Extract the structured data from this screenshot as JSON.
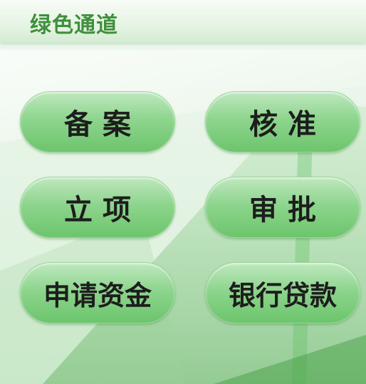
{
  "header": {
    "title": "绿色通道"
  },
  "buttons": [
    {
      "id": "filing",
      "label": "备案"
    },
    {
      "id": "approval-check",
      "label": "核准"
    },
    {
      "id": "project-setup",
      "label": "立项"
    },
    {
      "id": "review",
      "label": "审批"
    },
    {
      "id": "fund-application",
      "label": "申请资金"
    },
    {
      "id": "bank-loan",
      "label": "银行贷款"
    }
  ],
  "colors": {
    "accent": "#3f8f3c",
    "button_top": "#bfe8bf",
    "button_bottom": "#6cc56c",
    "background": "#e6f4e6"
  }
}
